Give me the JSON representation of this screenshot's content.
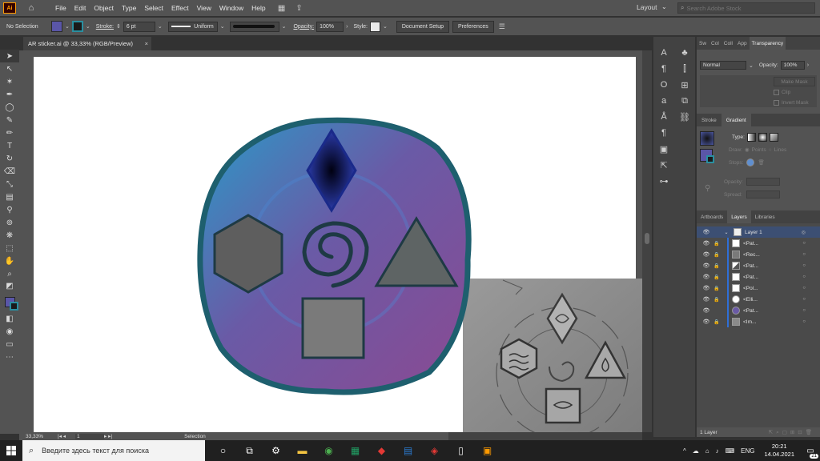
{
  "app": {
    "logo": "Ai",
    "document_tab": "AR sticker.ai @ 33,33% (RGB/Preview)",
    "tab_close": "×"
  },
  "menu": [
    "File",
    "Edit",
    "Object",
    "Type",
    "Select",
    "Effect",
    "View",
    "Window",
    "Help"
  ],
  "header": {
    "layout_label": "Layout",
    "stock_search_placeholder": "Search Adobe Stock"
  },
  "control": {
    "selection_label": "No Selection",
    "stroke_label": "Stroke:",
    "stroke_weight": "6 pt",
    "stroke_profile": "Uniform",
    "opacity_label": "Opacity:",
    "opacity_value": "100%",
    "style_label": "Style:",
    "document_setup": "Document Setup",
    "preferences": "Preferences"
  },
  "status": {
    "zoom": "33,33%",
    "page": "1",
    "mode": "Selection"
  },
  "transparency": {
    "tabs": [
      "Sw",
      "Col",
      "Coll",
      "App",
      "Transparency"
    ],
    "blend_mode": "Normal",
    "opacity_label": "Opacity:",
    "opacity_value": "100%",
    "make_mask": "Make Mask",
    "clip": "Clip",
    "invert_mask": "Invert Mask"
  },
  "gradient": {
    "tabs": [
      "Stroke",
      "Gradient"
    ],
    "type_label": "Type:",
    "draw_label": "Draw:",
    "points_label": "Points",
    "lines_label": "Lines",
    "stops_label": "Stops:",
    "opacity_label": "Opacity:",
    "spread_label": "Spread:"
  },
  "layers": {
    "tabs": [
      "Artboards",
      "Layers",
      "Libraries"
    ],
    "parent": "Layer 1",
    "items": [
      "<Pat...",
      "<Rec...",
      "<Pat...",
      "<Pat...",
      "<Pol...",
      "<Elli...",
      "<Pat...",
      "<Im..."
    ],
    "footer": "1 Layer"
  },
  "taskbar": {
    "search_placeholder": "Введите здесь текст для поиска",
    "language": "ENG",
    "time": "20:21",
    "date": "14.04.2021",
    "notifications": "21"
  },
  "colors": {
    "ui_dark": "#323232",
    "ui_mid": "#535353",
    "selection_blue": "#3c4f73",
    "sticker_teal": "#1e5f6e",
    "sticker_purple": "#8a4a92",
    "shape_gray": "#5e5e5e",
    "accent_orange": "#ff9a00"
  }
}
